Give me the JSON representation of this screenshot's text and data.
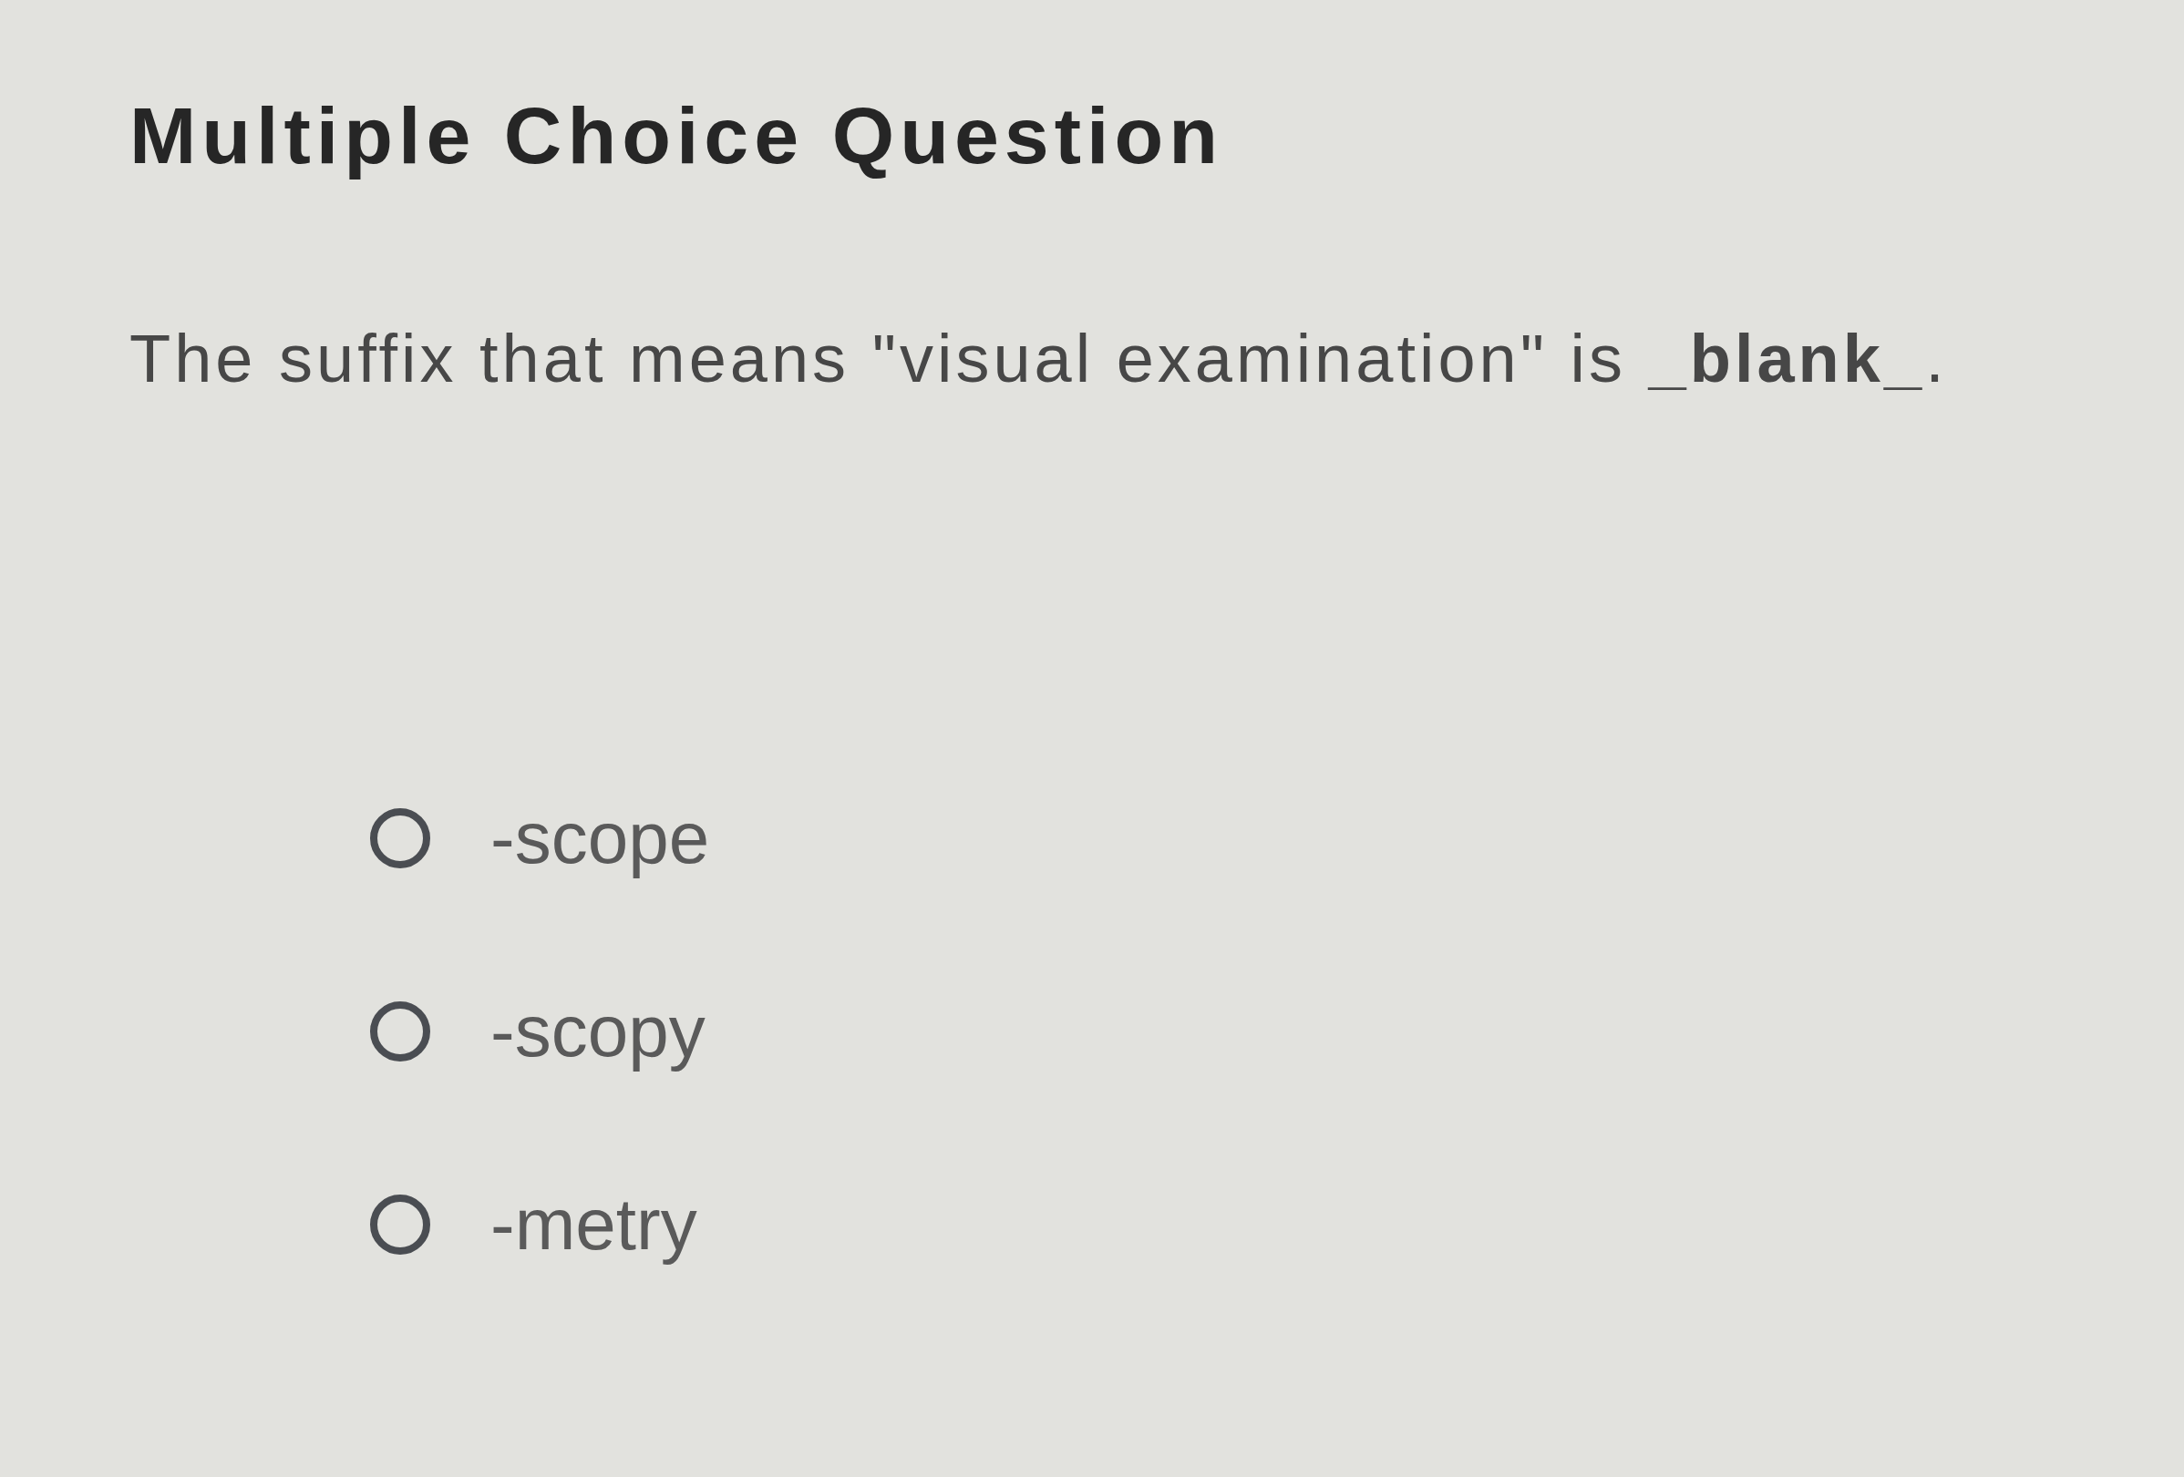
{
  "title": "Multiple Choice Question",
  "question": "The suffix that means \"visual examination\" is **_blank_**.",
  "options": [
    {
      "label": "-scope",
      "selected": false
    },
    {
      "label": "-scopy",
      "selected": false
    },
    {
      "label": "-metry",
      "selected": false
    }
  ]
}
